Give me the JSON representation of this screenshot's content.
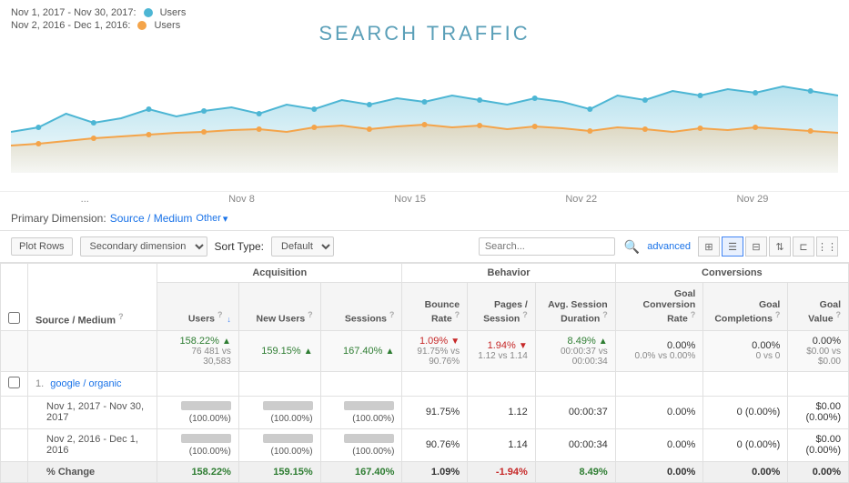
{
  "legend": {
    "row1": {
      "dates": "Nov 1, 2017 - Nov 30, 2017:",
      "metric": "Users"
    },
    "row2": {
      "dates": "Nov 2, 2016 - Dec 1, 2016:",
      "metric": "Users"
    }
  },
  "chart": {
    "title": "SEARCH TRAFFIC",
    "xLabels": [
      "...",
      "Nov 8",
      "Nov 15",
      "Nov 22",
      "Nov 29"
    ]
  },
  "dimension": {
    "label": "Primary Dimension:",
    "value": "Source / Medium",
    "other": "Other"
  },
  "toolbar": {
    "plot_rows": "Plot Rows",
    "secondary_dimension": "Secondary dimension",
    "sort_type_label": "Sort Type:",
    "sort_type_value": "Default",
    "search_placeholder": "Search...",
    "advanced": "advanced"
  },
  "table": {
    "col_groups": [
      "",
      "Acquisition",
      "Behavior",
      "Conversions"
    ],
    "headers": {
      "source_medium": "Source / Medium",
      "users": "Users",
      "new_users": "New Users",
      "sessions": "Sessions",
      "bounce_rate": "Bounce Rate",
      "pages_session": "Pages / Session",
      "avg_session_duration": "Avg. Session Duration",
      "goal_conversion_rate": "Goal Conversion Rate",
      "goal_completions": "Goal Completions",
      "goal_value": "Goal Value"
    },
    "totals": {
      "users": "158.22%",
      "users_sub": "76 481 vs 30,583",
      "users_trend": "up",
      "new_users": "159.15%",
      "new_users_sub": "",
      "new_users_trend": "up",
      "sessions": "167.40%",
      "sessions_sub": "",
      "sessions_trend": "up",
      "bounce_rate": "1.09%",
      "bounce_rate_sub": "91.75% vs 90.76%",
      "bounce_rate_trend": "down",
      "pages_session": "1.94%",
      "pages_session_sub": "1.12 vs 1.14",
      "pages_session_trend": "down",
      "avg_session": "8.49%",
      "avg_session_sub": "00:00:37 vs 00:00:34",
      "avg_session_trend": "up",
      "goal_conversion": "0.00%",
      "goal_conversion_sub": "0.0% vs 0.00%",
      "goal_completions": "0.00%",
      "goal_completions_sub": "0 vs 0",
      "goal_value": "0.00%",
      "goal_value_sub": "$0.00 vs $0.00"
    },
    "rows": [
      {
        "num": "1.",
        "name": "google / organic",
        "sub_rows": [
          {
            "label": "Nov 1, 2017 - Nov 30, 2017",
            "users_bar": true,
            "users_pct": "(100.00%)",
            "new_users_bar": true,
            "new_users_pct": "(100.00%)",
            "sessions_bar": true,
            "sessions_pct": "(100.00%)",
            "bounce_rate": "91.75%",
            "pages_session": "1.12",
            "avg_session": "00:00:37",
            "goal_conversion": "0.00%",
            "goal_completions": "0 (0.00%)",
            "goal_value": "$0.00 (0.00%)"
          },
          {
            "label": "Nov 2, 2016 - Dec 1, 2016",
            "users_bar": true,
            "users_pct": "(100.00%)",
            "new_users_bar": true,
            "new_users_pct": "(100.00%)",
            "sessions_bar": true,
            "sessions_pct": "(100.00%)",
            "bounce_rate": "90.76%",
            "pages_session": "1.14",
            "avg_session": "00:00:34",
            "goal_conversion": "0.00%",
            "goal_completions": "0 (0.00%)",
            "goal_value": "$0.00 (0.00%)"
          }
        ],
        "pct_change": {
          "users": "158.22%",
          "new_users": "159.15%",
          "sessions": "167.40%",
          "bounce_rate": "1.09%",
          "pages_session": "-1.94%",
          "avg_session": "8.49%",
          "goal_conversion": "0.00%",
          "goal_completions": "0.00%",
          "goal_value": "0.00%"
        }
      }
    ]
  }
}
